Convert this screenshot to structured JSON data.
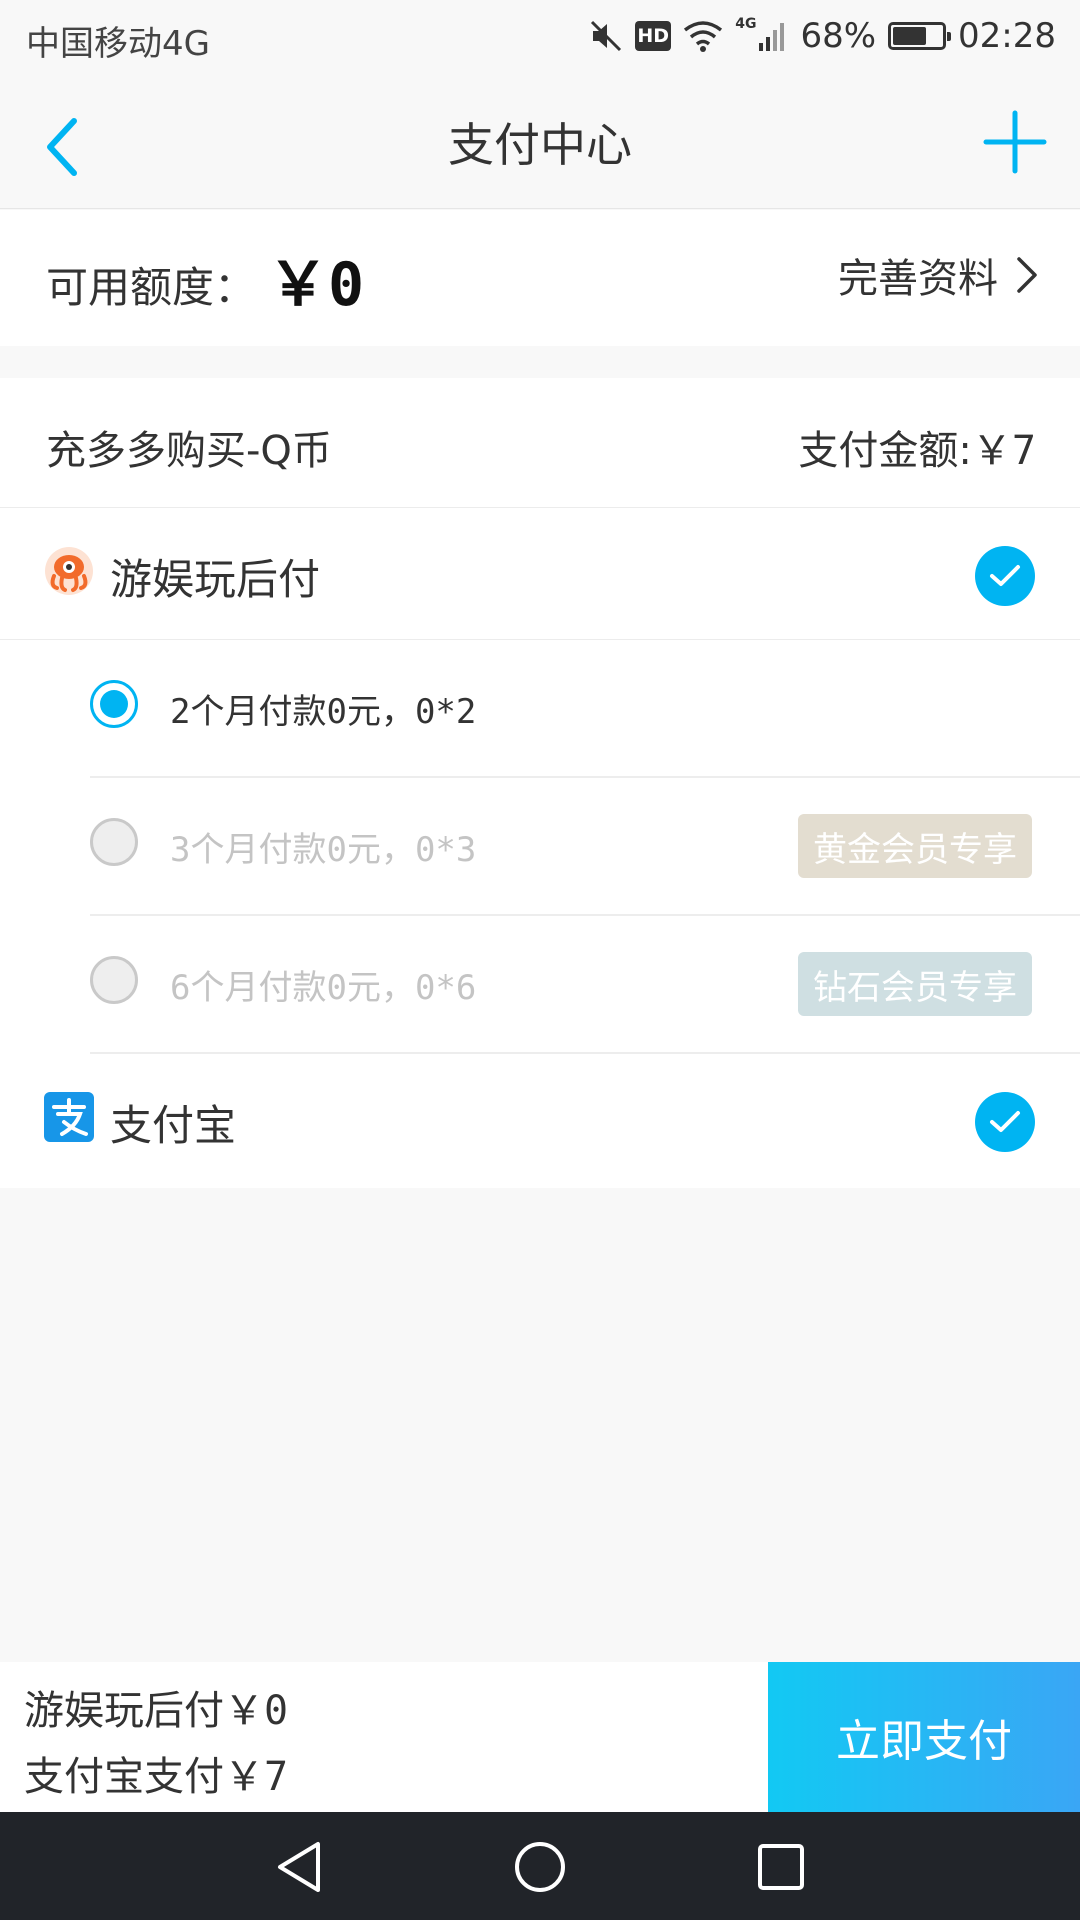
{
  "status_bar": {
    "carrier": "中国移动4G",
    "hd": "HD",
    "network": "4G",
    "battery_text": "68%",
    "battery_level": 0.68,
    "time": "02:28"
  },
  "header": {
    "title": "支付中心",
    "back_icon": "chevron-left-icon",
    "add_icon": "plus-icon"
  },
  "credit": {
    "label": "可用额度：",
    "value": "￥0",
    "profile_link": "完善资料"
  },
  "order": {
    "name": "充多多购买-Q币",
    "amount_label": "支付金额:",
    "amount_value": "￥7"
  },
  "methods": {
    "installment": {
      "label": "游娱玩后付",
      "icon": "octopus-logo-icon",
      "checked": true
    },
    "plans": [
      {
        "text": "2个月付款0元，0*2",
        "selected": true,
        "enabled": true,
        "badge": ""
      },
      {
        "text": "3个月付款0元，0*3",
        "selected": false,
        "enabled": false,
        "badge": "黄金会员专享"
      },
      {
        "text": "6个月付款0元，0*6",
        "selected": false,
        "enabled": false,
        "badge": "钻石会员专享"
      }
    ],
    "alipay": {
      "label": "支付宝",
      "icon": "alipay-logo-icon",
      "checked": true
    }
  },
  "summary": {
    "installment_label": "游娱玩后付",
    "installment_amount": "￥0",
    "alipay_label": "支付宝支付",
    "alipay_amount": "￥7"
  },
  "actions": {
    "pay_now": "立即支付"
  },
  "colors": {
    "accent": "#00b4f2",
    "gold_badge": "#e3ddd0",
    "diamond_badge": "#cfdfe2",
    "nav_bar": "#212429"
  }
}
